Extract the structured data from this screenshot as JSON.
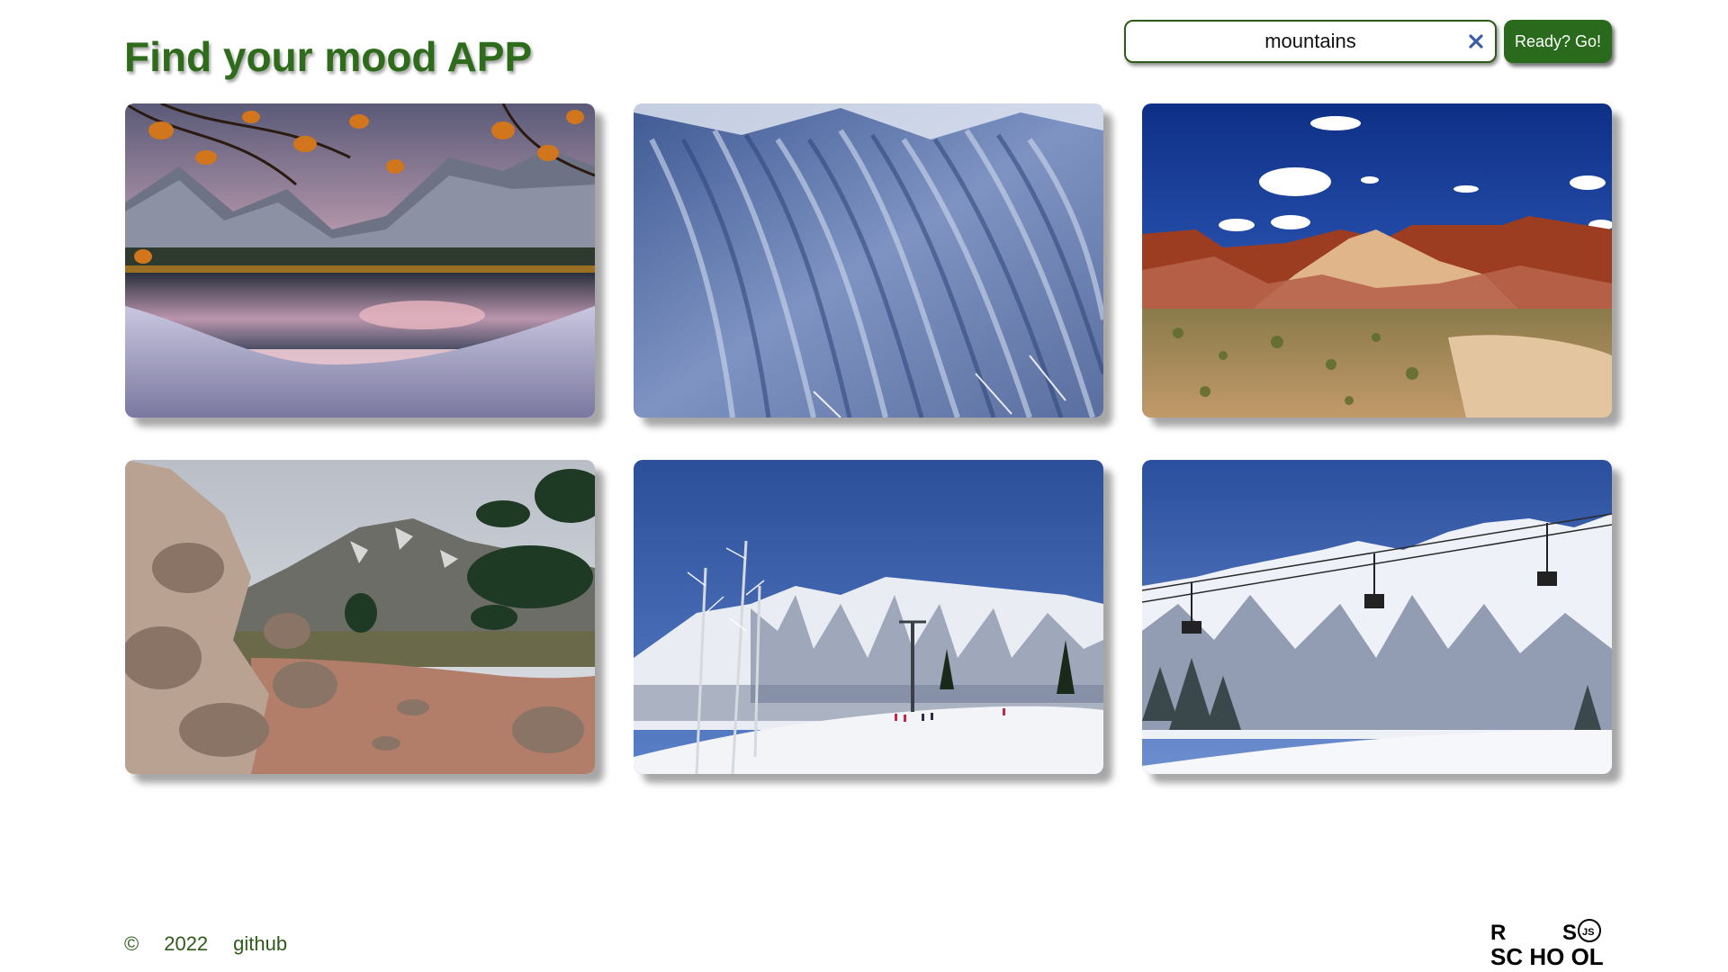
{
  "header": {
    "title": "Find your mood APP"
  },
  "search": {
    "value": "mountains",
    "button_label": "Ready? Go!",
    "clear_icon": "close-icon"
  },
  "gallery": {
    "photos": [
      {
        "subject": "autumn lake reflection with snowy mountains"
      },
      {
        "subject": "ridged blue mountain slopes"
      },
      {
        "subject": "red rock desert plateau under blue sky"
      },
      {
        "subject": "rocky trail with mountain and pines"
      },
      {
        "subject": "ski slope with snowy peaks and lift"
      },
      {
        "subject": "chairlift over snowy mountains"
      }
    ]
  },
  "footer": {
    "copyright": "©",
    "year": "2022",
    "github_label": "github",
    "logo_text_line1": "R S",
    "logo_text_line2": "SCHOOL",
    "logo_badge": "JS"
  },
  "colors": {
    "accent": "#2e6b1b",
    "button_bg": "#2a6a1c",
    "clear_icon": "#3a5da8"
  }
}
